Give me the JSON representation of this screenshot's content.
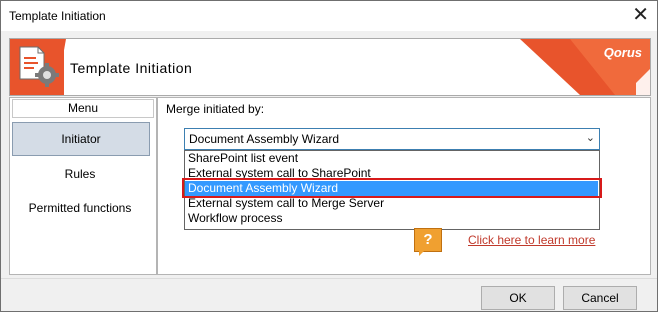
{
  "window": {
    "title": "Template Initiation",
    "close_glyph": "✕"
  },
  "header": {
    "title": "Template Initiation",
    "logo_text": "Qorus",
    "brand_color": "#e8542c"
  },
  "sidebar": {
    "menu_label": "Menu",
    "items": [
      {
        "label": "Initiator",
        "selected": true
      },
      {
        "label": "Rules",
        "selected": false
      },
      {
        "label": "Permitted functions",
        "selected": false
      }
    ]
  },
  "main": {
    "merge_label": "Merge initiated by:",
    "selected_value": "Document Assembly Wizard",
    "options": [
      "SharePoint list event",
      "External system call to SharePoint",
      "Document Assembly Wizard",
      "External system call to Merge Server",
      "Workflow process"
    ],
    "highlighted_option": "Document Assembly Wizard",
    "help_glyph": "?",
    "help_link": "Click here to learn more"
  },
  "footer": {
    "ok": "OK",
    "cancel": "Cancel"
  },
  "colors": {
    "selection": "#3399ff",
    "highlight_border": "#d71a1a",
    "link": "#c0392b"
  }
}
